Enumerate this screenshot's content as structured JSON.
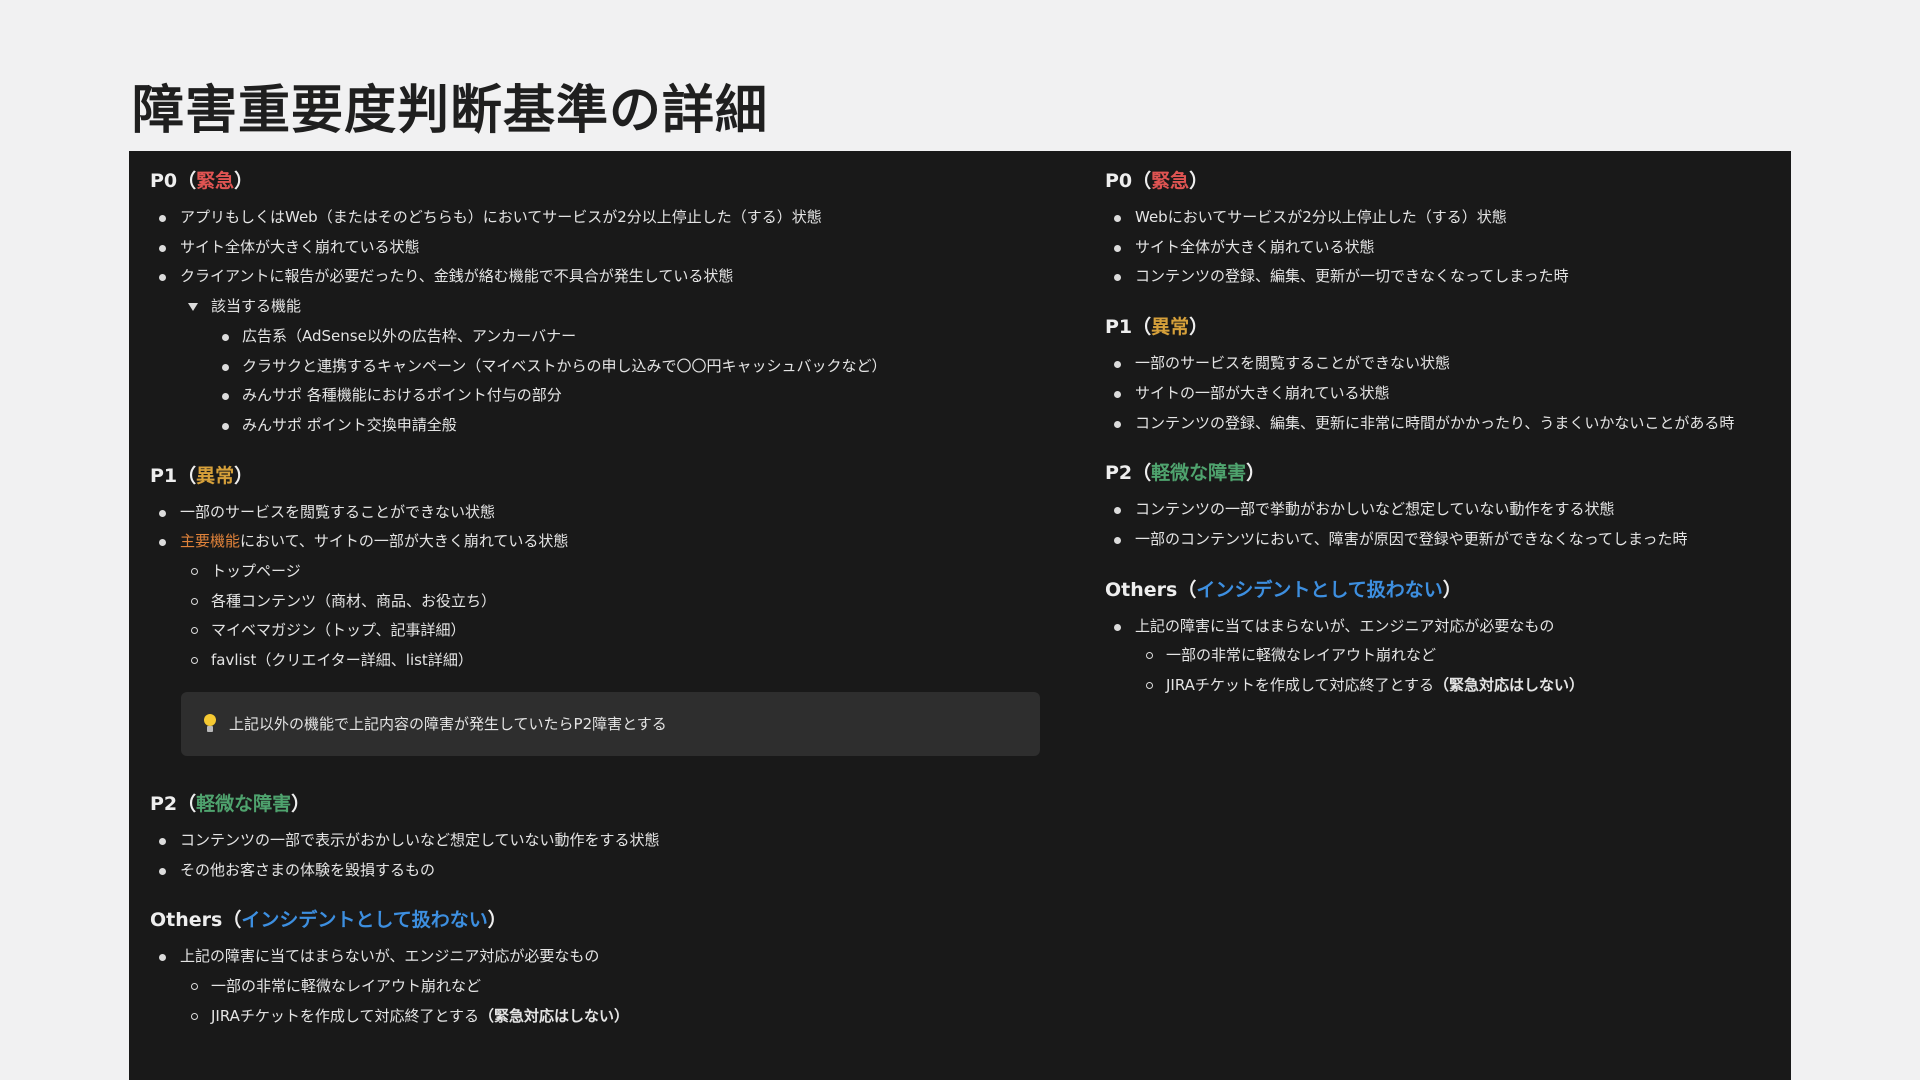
{
  "title": "障害重要度判断基準の詳細",
  "left": {
    "p0": {
      "label": "P0（",
      "tag": "緊急",
      "close": "）",
      "items": [
        "アプリもしくはWeb（またはそのどちらも）においてサービスが2分以上停止した（する）状態",
        "サイト全体が大きく崩れている状態",
        "クライアントに報告が必要だったり、金銭が絡む機能で不具合が発生している状態"
      ],
      "toggle": "該当する機能",
      "sub": [
        "広告系（AdSense以外の広告枠、アンカーバナー",
        "クラサクと連携するキャンペーン（マイベストからの申し込みで〇〇円キャッシュバックなど）",
        "みんサポ 各種機能におけるポイント付与の部分",
        "みんサポ ポイント交換申請全般"
      ]
    },
    "p1": {
      "label": "P1（",
      "tag": "異常",
      "close": "）",
      "item1": "一部のサービスを閲覧することができない状態",
      "item2_highlight": "主要機能",
      "item2_rest": "において、サイトの一部が大きく崩れている状態",
      "sub": [
        "トップページ",
        "各種コンテンツ（商材、商品、お役立ち）",
        "マイベマガジン（トップ、記事詳細）",
        "favlist（クリエイター詳細、list詳細）"
      ],
      "callout": "上記以外の機能で上記内容の障害が発生していたらP2障害とする"
    },
    "p2": {
      "label": "P2（",
      "tag": "軽微な障害",
      "close": "）",
      "items": [
        "コンテンツの一部で表示がおかしいなど想定していない動作をする状態",
        "その他お客さまの体験を毀損するもの"
      ]
    },
    "others": {
      "label": "Others（",
      "tag": "インシデントとして扱わない",
      "close": "）",
      "item": "上記の障害に当てはまらないが、エンジニア対応が必要なもの",
      "sub1": "一部の非常に軽微なレイアウト崩れなど",
      "sub2_main": "JIRAチケットを作成して対応終了とする",
      "sub2_bold": "（緊急対応はしない）"
    }
  },
  "right": {
    "p0": {
      "label": "P0（",
      "tag": "緊急",
      "close": "）",
      "items": [
        "Webにおいてサービスが2分以上停止した（する）状態",
        "サイト全体が大きく崩れている状態",
        "コンテンツの登録、編集、更新が一切できなくなってしまった時"
      ]
    },
    "p1": {
      "label": "P1（",
      "tag": "異常",
      "close": "）",
      "items": [
        "一部のサービスを閲覧することができない状態",
        "サイトの一部が大きく崩れている状態",
        "コンテンツの登録、編集、更新に非常に時間がかかったり、うまくいかないことがある時"
      ]
    },
    "p2": {
      "label": "P2（",
      "tag": "軽微な障害",
      "close": "）",
      "items": [
        "コンテンツの一部で挙動がおかしいなど想定していない動作をする状態",
        "一部のコンテンツにおいて、障害が原因で登録や更新ができなくなってしまった時"
      ]
    },
    "others": {
      "label": "Others（",
      "tag": "インシデントとして扱わない",
      "close": "）",
      "item": "上記の障害に当てはまらないが、エンジニア対応が必要なもの",
      "sub1": "一部の非常に軽微なレイアウト崩れなど",
      "sub2_main": "JIRAチケットを作成して対応終了とする",
      "sub2_bold": "（緊急対応はしない）"
    }
  },
  "colors": {
    "p0_tag": "#df5452",
    "p1_tag": "#d6a03a",
    "p2_tag": "#4fa36e",
    "others_tag": "#3d8fe0",
    "highlight": "#e0823a",
    "panel_bg": "#191919",
    "page_bg": "#f1f1f2"
  },
  "icons": {
    "callout": "lightbulb-icon"
  }
}
